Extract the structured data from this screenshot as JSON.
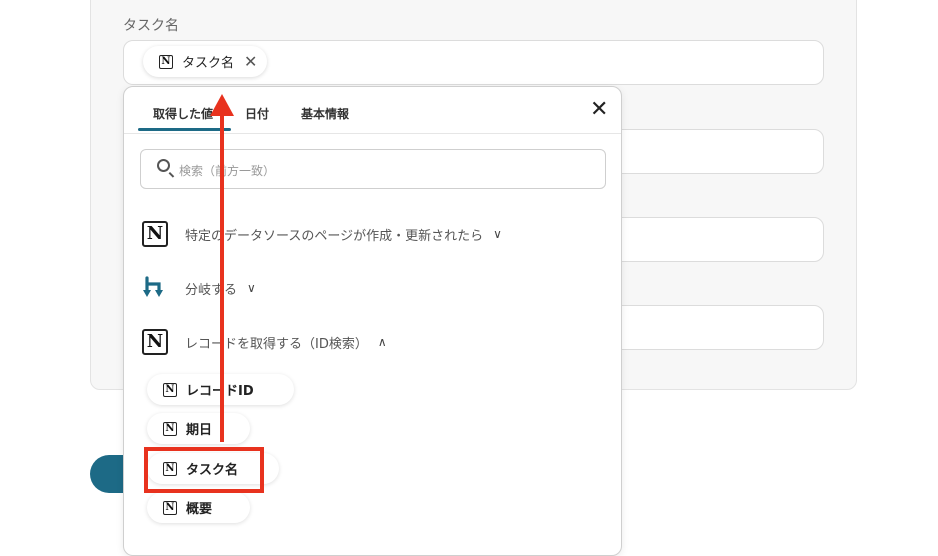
{
  "form": {
    "task_name_label": "タスク名",
    "selected_token": "タスク名"
  },
  "panel": {
    "tabs": [
      "取得した値",
      "日付",
      "基本情報"
    ],
    "search_placeholder": "検索（前方一致）",
    "sections": [
      {
        "label": "特定のデータソースのページが作成・更新されたら",
        "chevron": "⌄"
      },
      {
        "label": "分岐する",
        "chevron": "⌄"
      },
      {
        "label": "レコードを取得する（ID検索）",
        "chevron": "⌃"
      }
    ],
    "items": [
      "レコードID",
      "期日",
      "タスク名",
      "概要"
    ]
  },
  "icons": {
    "notion": "notion-icon",
    "branch": "branch-icon",
    "close": "close-icon",
    "search": "search-icon"
  },
  "colors": {
    "accent": "#1d6a86",
    "highlight": "#e8321e"
  }
}
